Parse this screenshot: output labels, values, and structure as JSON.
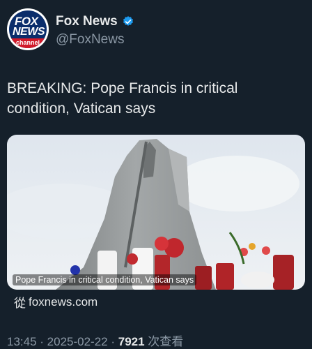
{
  "account": {
    "avatar_logo": [
      "FOX",
      "NEWS",
      "channel"
    ],
    "display_name": "Fox News",
    "handle": "@FoxNews",
    "verified": true
  },
  "tweet": {
    "text": "BREAKING: Pope Francis in critical condition, Vatican says"
  },
  "media": {
    "caption": "Pope Francis in critical condition, Vatican says"
  },
  "source": {
    "prefix": "從",
    "domain": "foxnews.com"
  },
  "meta": {
    "time": "13:45",
    "separator": " · ",
    "date": "2025-02-22",
    "views": "7921",
    "views_label": " 次查看"
  },
  "colors": {
    "background": "#15202b",
    "text": "#e7e9ea",
    "secondary_text": "#8b98a5",
    "verified": "#1d9bf0",
    "brand_red": "#d11a2a",
    "brand_blue": "#0a2d6b"
  }
}
